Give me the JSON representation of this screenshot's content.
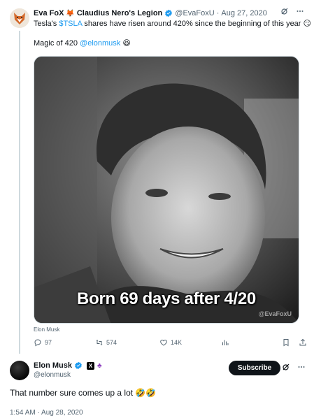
{
  "quoted_tweet": {
    "author_name": "Eva FoX",
    "author_name_suffix": "Claudius Nero's Legion",
    "author_emoji": "🦊",
    "handle": "@EvaFoxU",
    "separator": "·",
    "date": "Aug 27, 2020",
    "text_line1_prefix": "Tesla's ",
    "text_cashtag": "$TSLA",
    "text_line1_suffix": " shares have risen around 420% since the beginning of this year",
    "text_line1_emoji": "😏",
    "text_line2_prefix": "Magic of 420 ",
    "text_mention": "@elonmusk",
    "text_line2_emoji": "😆",
    "media": {
      "caption": "Born 69 days after 4/20",
      "watermark": "@EvaFoxU",
      "tag": "Elon Musk"
    },
    "actions": {
      "replies": "97",
      "reposts": "574",
      "likes": "14K"
    }
  },
  "main_tweet": {
    "author_name": "Elon Musk",
    "badge_x": "X",
    "badge_extra": "♣",
    "handle": "@elonmusk",
    "subscribe_label": "Subscribe",
    "text": "That number sure comes up a lot 🤣🤣",
    "timestamp": "1:54 AM · Aug 28, 2020"
  },
  "colors": {
    "link": "#1d9bf0",
    "muted": "#536471",
    "verified": "#1d9bf0",
    "subscribe_bg": "#0f1419"
  },
  "icons": [
    "grok-icon",
    "more-icon",
    "reply-icon",
    "repost-icon",
    "like-icon",
    "views-icon",
    "bookmark-icon",
    "share-icon",
    "verified-icon"
  ]
}
